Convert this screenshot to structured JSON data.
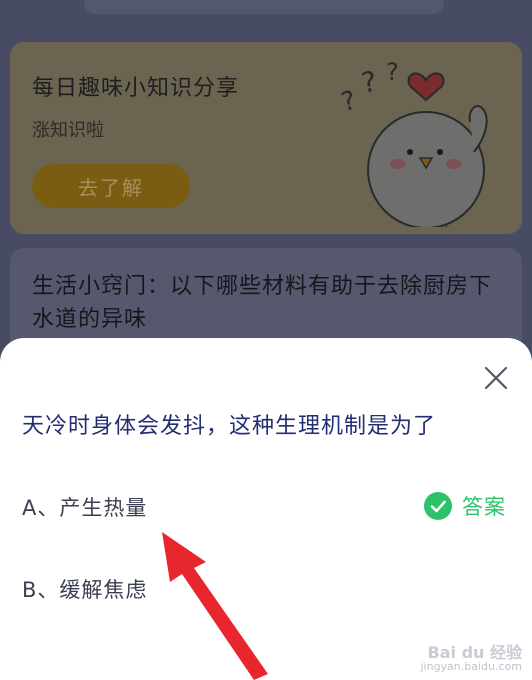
{
  "promo": {
    "title": "每日趣味小知识分享",
    "subtitle": "涨知识啦",
    "button_label": "去了解"
  },
  "tip": {
    "title": "生活小窍门：以下哪些材料有助于去除厨房下水道的异味"
  },
  "quiz": {
    "question": "天冷时身体会发抖，这种生理机制是为了",
    "options": [
      {
        "label": "A、产生热量",
        "is_answer": true
      },
      {
        "label": "B、缓解焦虑",
        "is_answer": false
      }
    ],
    "answer_label": "答案",
    "answer_color": "#2cc26a"
  },
  "watermark": {
    "brand": "Bai du 经验",
    "url": "jingyan.baidu.com"
  },
  "colors": {
    "question_text": "#232d72",
    "annotation_arrow": "#e8262d"
  }
}
